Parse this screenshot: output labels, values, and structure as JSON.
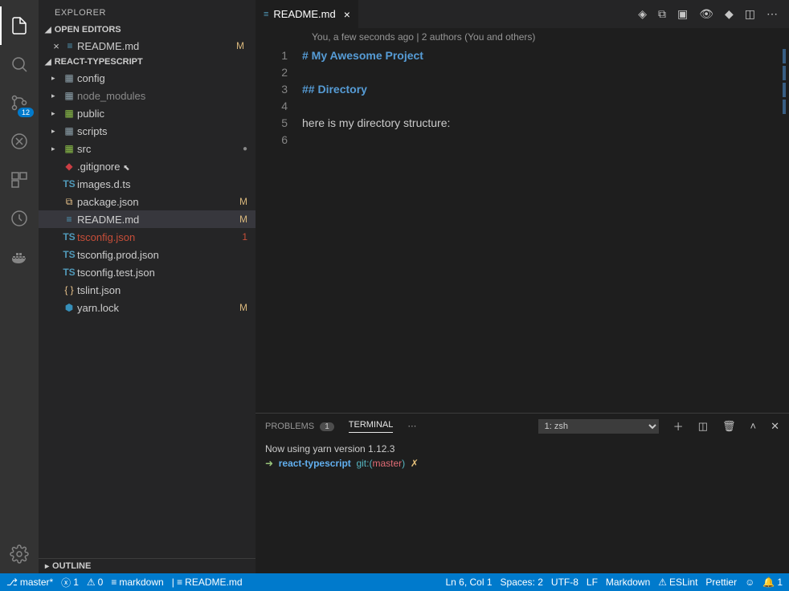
{
  "sidebar_title": "EXPLORER",
  "activity_badge": "12",
  "open_editors": {
    "label": "OPEN EDITORS",
    "items": [
      {
        "name": "README.md",
        "mark": "M",
        "icon": "≡"
      }
    ]
  },
  "project": {
    "label": "REACT-TYPESCRIPT",
    "tree": [
      {
        "name": "config",
        "type": "folder",
        "icon": "▦",
        "ic": "ic-fold"
      },
      {
        "name": "node_modules",
        "type": "folder",
        "icon": "▦",
        "ic": "ic-fold",
        "dim": true
      },
      {
        "name": "public",
        "type": "folder",
        "icon": "▦",
        "ic": "ic-fold-g"
      },
      {
        "name": "scripts",
        "type": "folder",
        "icon": "▦",
        "ic": "ic-fold"
      },
      {
        "name": "src",
        "type": "folder",
        "icon": "▦",
        "ic": "ic-fold-g",
        "dot": true
      },
      {
        "name": ".gitignore",
        "type": "file",
        "icon": "◆",
        "ic": "ic-red",
        "cursor": true
      },
      {
        "name": "images.d.ts",
        "type": "file",
        "icon": "TS",
        "ic": "ic-ts"
      },
      {
        "name": "package.json",
        "type": "file",
        "icon": "⧉",
        "ic": "ic-json",
        "mark": "M"
      },
      {
        "name": "README.md",
        "type": "file",
        "icon": "≡",
        "ic": "ic-md",
        "mark": "M",
        "selected": true
      },
      {
        "name": "tsconfig.json",
        "type": "file",
        "icon": "TS",
        "ic": "ic-ts",
        "red": true,
        "mark": "1",
        "markred": true
      },
      {
        "name": "tsconfig.prod.json",
        "type": "file",
        "icon": "TS",
        "ic": "ic-ts"
      },
      {
        "name": "tsconfig.test.json",
        "type": "file",
        "icon": "TS",
        "ic": "ic-ts"
      },
      {
        "name": "tslint.json",
        "type": "file",
        "icon": "{ }",
        "ic": "ic-json"
      },
      {
        "name": "yarn.lock",
        "type": "file",
        "icon": "⬢",
        "ic": "ic-yarn",
        "mark": "M"
      }
    ]
  },
  "outline_label": "OUTLINE",
  "tab": {
    "name": "README.md",
    "icon": "≡"
  },
  "crumb": "You, a few seconds ago | 2 authors (You and others)",
  "code": {
    "lines": [
      {
        "n": "1",
        "text": "# My Awesome Project",
        "cls": "md-heading"
      },
      {
        "n": "2",
        "text": "",
        "cls": ""
      },
      {
        "n": "3",
        "text": "## Directory",
        "cls": "md-heading"
      },
      {
        "n": "4",
        "text": "",
        "cls": ""
      },
      {
        "n": "5",
        "text": "here is my directory structure:",
        "cls": ""
      },
      {
        "n": "6",
        "text": "",
        "cls": ""
      }
    ]
  },
  "panel": {
    "problems": "PROBLEMS",
    "problems_count": "1",
    "terminal": "TERMINAL",
    "shell": "1: zsh",
    "line1": "Now using yarn version 1.12.3",
    "prompt_arrow": "➜",
    "prompt_path": "react-typescript",
    "prompt_git": "git:(",
    "prompt_branch": "master",
    "prompt_git2": ")",
    "prompt_x": "✗"
  },
  "status": {
    "branch": "master*",
    "errors": "1",
    "warnings": "0",
    "md": "markdown",
    "file": "README.md",
    "lncol": "Ln 6, Col 1",
    "spaces": "Spaces: 2",
    "enc": "UTF-8",
    "eol": "LF",
    "lang": "Markdown",
    "eslint": "ESLint",
    "prettier": "Prettier",
    "bell": "1"
  }
}
